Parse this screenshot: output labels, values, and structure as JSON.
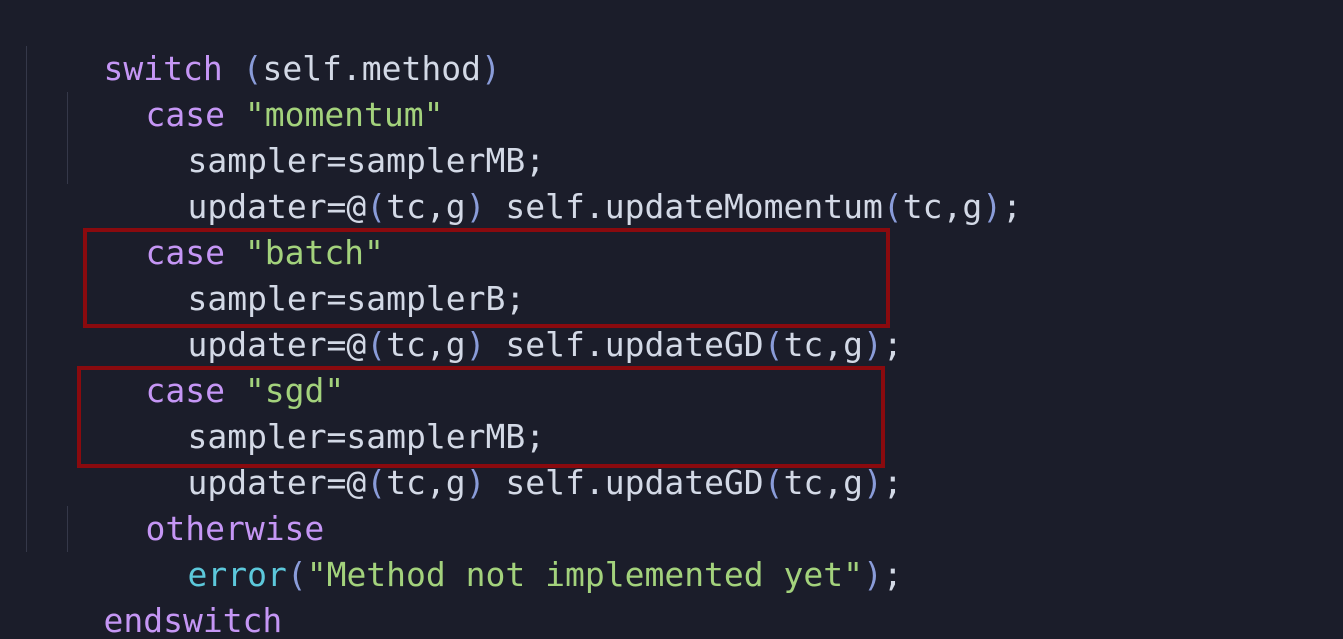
{
  "code": {
    "line1": {
      "kw": "switch",
      "sp": " ",
      "lparen": "(",
      "expr": "self.method",
      "rparen": ")"
    },
    "line2": {
      "kw": "case",
      "sp": " ",
      "str": "\"momentum\""
    },
    "line3": {
      "text": "sampler=samplerMB;"
    },
    "line4": {
      "pre": "updater=@",
      "lp1": "(",
      "args1": "tc,g",
      "rp1": ")",
      "mid": " self.updateMomentum",
      "lp2": "(",
      "args2": "tc,g",
      "rp2": ")",
      "end": ";"
    },
    "line5": {
      "kw": "case",
      "sp": " ",
      "str": "\"batch\""
    },
    "line6": {
      "text": "sampler=samplerB;"
    },
    "line7": {
      "pre": "updater=@",
      "lp1": "(",
      "args1": "tc,g",
      "rp1": ")",
      "mid": " self.updateGD",
      "lp2": "(",
      "args2": "tc,g",
      "rp2": ")",
      "end": ";"
    },
    "line8": {
      "kw": "case",
      "sp": " ",
      "str": "\"sgd\""
    },
    "line9": {
      "text": "sampler=samplerMB;"
    },
    "line10": {
      "pre": "updater=@",
      "lp1": "(",
      "args1": "tc,g",
      "rp1": ")",
      "mid": " self.updateGD",
      "lp2": "(",
      "args2": "tc,g",
      "rp2": ")",
      "end": ";"
    },
    "line11": {
      "kw": "otherwise"
    },
    "line12": {
      "fn": "error",
      "lp": "(",
      "str": "\"Method not implemented yet\"",
      "rp": ")",
      "end": ";"
    },
    "line13": {
      "kw": "endswitch"
    }
  },
  "colors": {
    "background": "#1b1d2a",
    "keyword": "#c596f5",
    "string": "#a3d27c",
    "paren": "#8a9cd9",
    "function": "#5cc8db",
    "text": "#d3d9e6",
    "highlight_border": "#8a0a0e",
    "squiggle": "#3aa8c4"
  }
}
